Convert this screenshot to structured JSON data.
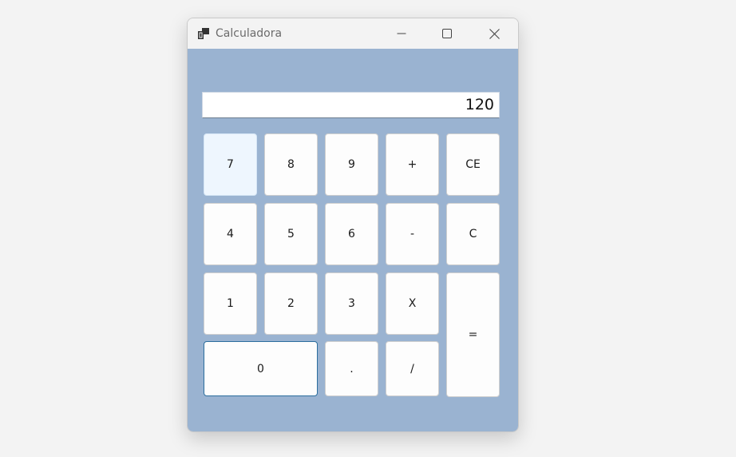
{
  "window": {
    "title": "Calculadora"
  },
  "display": {
    "value": "120"
  },
  "keys": {
    "k7": "7",
    "k8": "8",
    "k9": "9",
    "add": "+",
    "ce": "CE",
    "k4": "4",
    "k5": "5",
    "k6": "6",
    "sub": "-",
    "c": "C",
    "k1": "1",
    "k2": "2",
    "k3": "3",
    "mul": "X",
    "eq": "=",
    "k0": "0",
    "dot": ".",
    "div": "/"
  },
  "colors": {
    "client_bg": "#9ab3d1",
    "titlebar_bg": "#f3f3f3",
    "key_bg": "#fdfdfd",
    "focus_border": "#2c6e9e"
  },
  "icons": {
    "app": "calculator-window-icon",
    "minimize": "minimize-icon",
    "maximize": "maximize-icon",
    "close": "close-icon"
  }
}
